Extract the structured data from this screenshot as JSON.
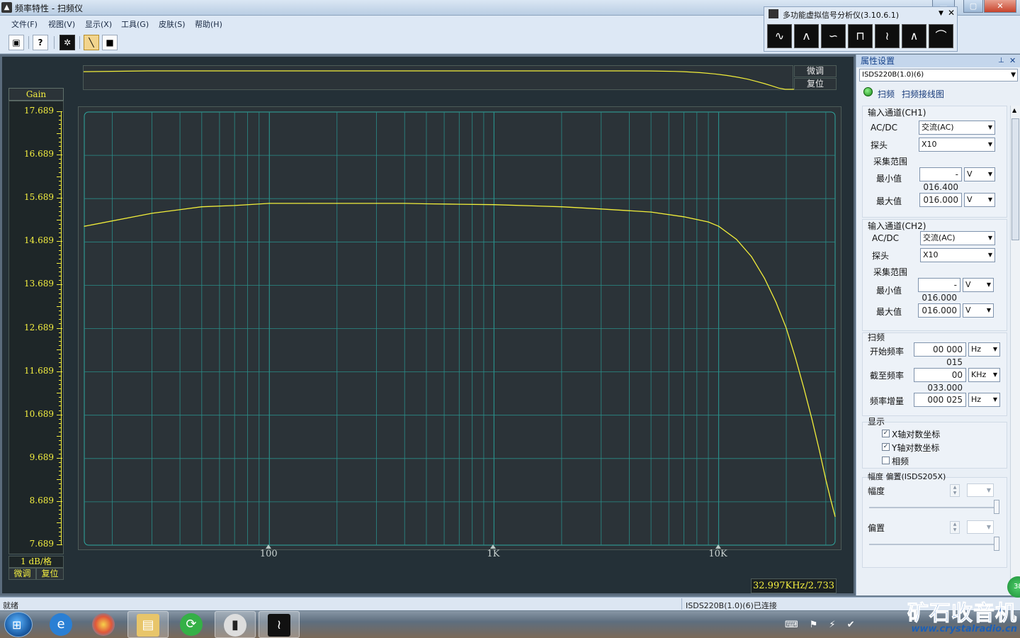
{
  "window": {
    "title": "频率特性 - 扫频仪",
    "min_icon": "minimize-icon",
    "max_icon": "maximize-icon",
    "close_icon": "close-icon"
  },
  "menu": [
    "文件(F)",
    "视图(V)",
    "显示(X)",
    "工具(G)",
    "皮肤(S)",
    "帮助(H)"
  ],
  "toolbar": {
    "buttons": [
      {
        "name": "save",
        "icon": "save-icon"
      },
      {
        "name": "help",
        "icon": "question-icon",
        "glyph": "?"
      },
      {
        "name": "zoom",
        "icon": "crosshair-icon"
      },
      {
        "name": "draw-line",
        "icon": "line-tool-icon",
        "active": true
      },
      {
        "name": "stop",
        "icon": "stop-icon"
      }
    ]
  },
  "mini_window": {
    "title": "多功能虚拟信号分析仪(3.10.6.1)",
    "buttons": [
      "scope-icon",
      "spectrum-icon",
      "recorder-icon",
      "generator-icon",
      "sweep-icon",
      "logic-icon",
      "filter-icon"
    ]
  },
  "gain_axis": {
    "title": "Gain",
    "ticks": [
      "17.689",
      "16.689",
      "15.689",
      "14.689",
      "13.689",
      "12.689",
      "11.689",
      "10.689",
      "9.689",
      "8.689",
      "7.689"
    ],
    "scale_label": "1 dB/格",
    "fine_label": "微调",
    "reset_label": "复位"
  },
  "overview": {
    "fine_label": "微调",
    "reset_label": "复位"
  },
  "readout": "32.997KHz/2.733",
  "chart_data": {
    "type": "line",
    "title": "",
    "xlabel": "",
    "ylabel": "Gain",
    "x_scale": "log",
    "xlim": [
      15,
      33000
    ],
    "ylim": [
      7.689,
      17.689
    ],
    "x_tick_labels": [
      "100",
      "1K",
      "10K"
    ],
    "grid": true,
    "series": [
      {
        "color": "#f2ee3a",
        "x": [
          15,
          30,
          50,
          70,
          100,
          150,
          200,
          300,
          400,
          500,
          700,
          1000,
          2000,
          3000,
          5000,
          7000,
          9000,
          10000,
          12000,
          14000,
          16000,
          18000,
          20000,
          22000,
          24000,
          26000,
          28000,
          30000,
          31500,
          32997
        ],
        "y": [
          15.05,
          15.35,
          15.5,
          15.53,
          15.58,
          15.58,
          15.58,
          15.58,
          15.58,
          15.57,
          15.56,
          15.55,
          15.5,
          15.45,
          15.38,
          15.27,
          15.15,
          15.05,
          14.75,
          14.35,
          13.85,
          13.3,
          12.7,
          12.0,
          11.3,
          10.6,
          9.9,
          9.2,
          8.75,
          8.35
        ]
      }
    ]
  },
  "panel": {
    "title": "属性设置",
    "device": "ISDS220B(1.0)(6)",
    "sweep_label": "扫频",
    "sweep_plot_label": "扫频接线图",
    "ch1": {
      "title": "输入通道(CH1)",
      "acdc_label": "AC/DC",
      "acdc_value": "交流(AC)",
      "probe_label": "探头",
      "probe_value": "X10",
      "range_title": "采集范围",
      "min_label": "最小值",
      "min_value": "- 016.400",
      "min_unit": "V",
      "max_label": "最大值",
      "max_value": "016.000",
      "max_unit": "V"
    },
    "ch2": {
      "title": "输入通道(CH2)",
      "acdc_label": "AC/DC",
      "acdc_value": "交流(AC)",
      "probe_label": "探头",
      "probe_value": "X10",
      "range_title": "采集范围",
      "min_label": "最小值",
      "min_value": "- 016.000",
      "min_unit": "V",
      "max_label": "最大值",
      "max_value": "016.000",
      "max_unit": "V"
    },
    "sweep": {
      "title": "扫频",
      "start_label": "开始频率",
      "start_value": "00 000 015",
      "start_unit": "Hz",
      "stop_label": "截至频率",
      "stop_value": "00 033.000",
      "stop_unit": "KHz",
      "step_label": "频率增量",
      "step_value": "000 025",
      "step_unit": "Hz"
    },
    "display": {
      "title": "显示",
      "xlog_label": "X轴对数坐标",
      "xlog_checked": true,
      "ylog_label": "Y轴对数坐标",
      "ylog_checked": true,
      "phase_label": "相频",
      "phase_checked": false
    },
    "amp": {
      "title": "幅度 偏置(ISDS205X)",
      "amp_label": "幅度",
      "offset_label": "偏置"
    }
  },
  "status": {
    "left": "就绪",
    "right": "ISDS220B(1.0)(6)已连接",
    "badge": "38"
  },
  "watermark": {
    "line1": "矿石收音机",
    "line2": "www.crystalradio.cn"
  }
}
